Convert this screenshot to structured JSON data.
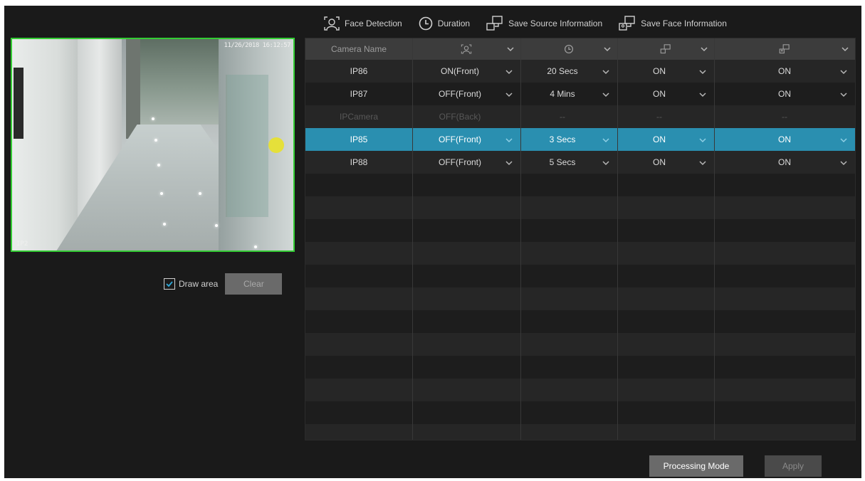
{
  "legend": {
    "face_detection": "Face Detection",
    "duration": "Duration",
    "save_source": "Save Source Information",
    "save_face": "Save Face Information"
  },
  "preview": {
    "timestamp": "11/26/2018 16:12:57",
    "camera_label": "IP2"
  },
  "draw_area": {
    "checked": true,
    "label": "Draw area",
    "clear_label": "Clear"
  },
  "table": {
    "header": {
      "camera_name": "Camera Name"
    },
    "rows": [
      {
        "camera": "IP86",
        "face_detection": "ON(Front)",
        "duration": "20 Secs",
        "save_source": "ON",
        "save_face": "ON",
        "state": "normal"
      },
      {
        "camera": "IP87",
        "face_detection": "OFF(Front)",
        "duration": "4 Mins",
        "save_source": "ON",
        "save_face": "ON",
        "state": "normal"
      },
      {
        "camera": "IPCamera",
        "face_detection": "OFF(Back)",
        "duration": "--",
        "save_source": "--",
        "save_face": "--",
        "state": "disabled"
      },
      {
        "camera": "IP85",
        "face_detection": "OFF(Front)",
        "duration": "3 Secs",
        "save_source": "ON",
        "save_face": "ON",
        "state": "selected"
      },
      {
        "camera": "IP88",
        "face_detection": "OFF(Front)",
        "duration": "5 Secs",
        "save_source": "ON",
        "save_face": "ON",
        "state": "normal"
      }
    ]
  },
  "buttons": {
    "processing_mode": "Processing Mode",
    "apply": "Apply"
  },
  "colors": {
    "selected_row": "#2a8fb0",
    "preview_border": "#33cc33",
    "background": "#1a1a1a"
  }
}
